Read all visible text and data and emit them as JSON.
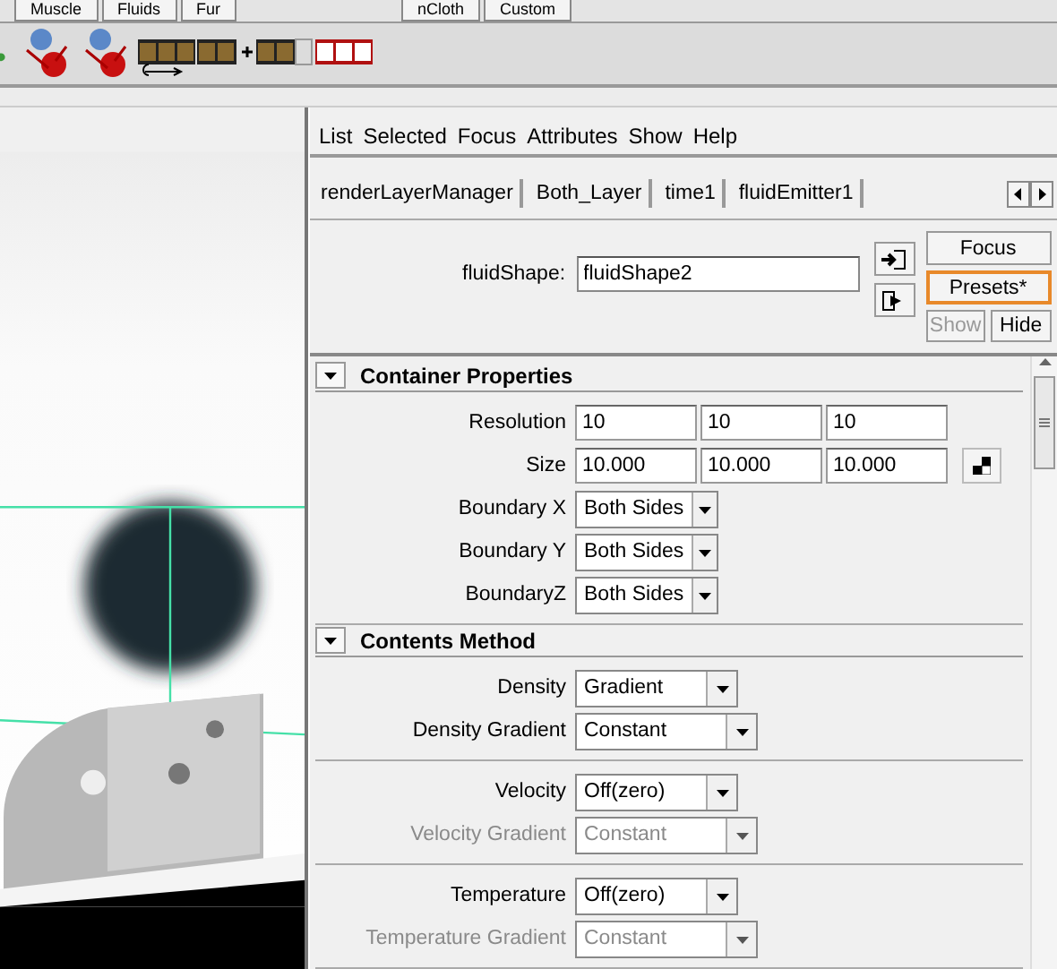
{
  "shelf_tabs": [
    {
      "label": "Muscle"
    },
    {
      "label": "Fluids"
    },
    {
      "label": "Fur"
    },
    {
      "label": "nCloth"
    },
    {
      "label": "Custom"
    }
  ],
  "menu": [
    "List",
    "Selected",
    "Focus",
    "Attributes",
    "Show",
    "Help"
  ],
  "node_tabs": [
    "renderLayerManager",
    "Both_Layer",
    "time1",
    "fluidEmitter1"
  ],
  "node": {
    "label": "fluidShape:",
    "value": "fluidShape2"
  },
  "side_buttons": [
    {
      "label": "Focus",
      "highlighted": false,
      "disabled": false
    },
    {
      "label": "Presets*",
      "highlighted": true,
      "disabled": false
    },
    {
      "label": "Show",
      "highlighted": false,
      "disabled": true
    },
    {
      "label": "Hide",
      "highlighted": false,
      "disabled": false
    }
  ],
  "sections": [
    {
      "title": "Container Properties",
      "expanded": true,
      "groups": [
        {
          "rows": [
            {
              "kind": "vector",
              "label": "Resolution",
              "values": [
                "10",
                "10",
                "10"
              ],
              "disabled": false
            },
            {
              "kind": "vector-lock",
              "label": "Size",
              "values": [
                "10.000",
                "10.000",
                "10.000"
              ],
              "disabled": false
            },
            {
              "kind": "dropdown",
              "label": "Boundary X",
              "value": "Both Sides",
              "disabled": false
            },
            {
              "kind": "dropdown",
              "label": "Boundary Y",
              "value": "Both Sides",
              "disabled": false
            },
            {
              "kind": "dropdown",
              "label": "BoundaryZ",
              "value": "Both Sides",
              "disabled": false
            }
          ]
        }
      ]
    },
    {
      "title": "Contents Method",
      "expanded": true,
      "groups": [
        {
          "rows": [
            {
              "kind": "dropdown",
              "label": "Density",
              "value": "Gradient",
              "disabled": false
            },
            {
              "kind": "dropdown",
              "label": "Density Gradient",
              "value": "Constant",
              "disabled": false
            }
          ]
        },
        {
          "rows": [
            {
              "kind": "dropdown",
              "label": "Velocity",
              "value": "Off(zero)",
              "disabled": false
            },
            {
              "kind": "dropdown",
              "label": "Velocity Gradient",
              "value": "Constant",
              "disabled": true
            }
          ]
        },
        {
          "rows": [
            {
              "kind": "dropdown",
              "label": "Temperature",
              "value": "Off(zero)",
              "disabled": false
            },
            {
              "kind": "dropdown",
              "label": "Temperature Gradient",
              "value": "Constant",
              "disabled": true
            }
          ]
        }
      ]
    }
  ]
}
